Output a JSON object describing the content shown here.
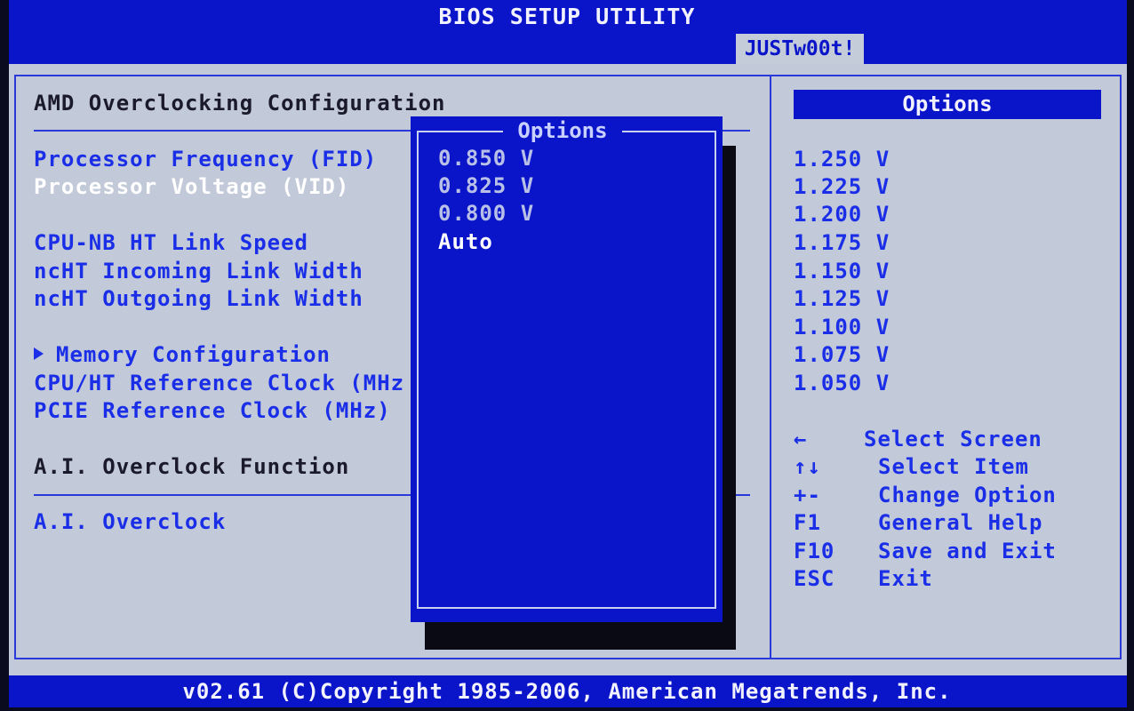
{
  "title": "BIOS SETUP UTILITY",
  "active_tab": "JUSTw00t!",
  "section_title": "AMD Overclocking Configuration",
  "settings": [
    {
      "label": "Processor Frequency (FID)"
    },
    {
      "label": "Processor Voltage (VID)"
    },
    {
      "label": "CPU-NB HT Link Speed"
    },
    {
      "label": "ncHT Incoming Link Width"
    },
    {
      "label": "ncHT Outgoing Link Width"
    },
    {
      "label": "Memory Configuration"
    },
    {
      "label": "CPU/HT Reference Clock (MHz"
    },
    {
      "label": "PCIE Reference Clock (MHz)"
    },
    {
      "label": "A.I. Overclock Function"
    },
    {
      "label": "A.I. Overclock"
    }
  ],
  "popup": {
    "title": "Options",
    "items": [
      "0.850 V",
      "0.825 V",
      "0.800 V",
      "Auto"
    ],
    "selected_index": 3
  },
  "right_panel": {
    "header": "Options",
    "values": [
      "1.250 V",
      "1.225 V",
      "1.200 V",
      "1.175 V",
      "1.150 V",
      "1.125 V",
      "1.100 V",
      "1.075 V",
      "1.050 V"
    ],
    "help": [
      {
        "key": "←",
        "text": "Select Screen"
      },
      {
        "key": "↑↓",
        "text": "Select Item"
      },
      {
        "key": "+-",
        "text": "Change Option"
      },
      {
        "key": "F1",
        "text": "General Help"
      },
      {
        "key": "F10",
        "text": "Save and Exit"
      },
      {
        "key": "ESC",
        "text": "Exit"
      }
    ]
  },
  "footer": "v02.61 (C)Copyright 1985-2006, American Megatrends, Inc.",
  "colors": {
    "bios_blue": "#0a14c8",
    "panel_gray": "#c2c9d8",
    "text_blue": "#1a2ee8"
  }
}
